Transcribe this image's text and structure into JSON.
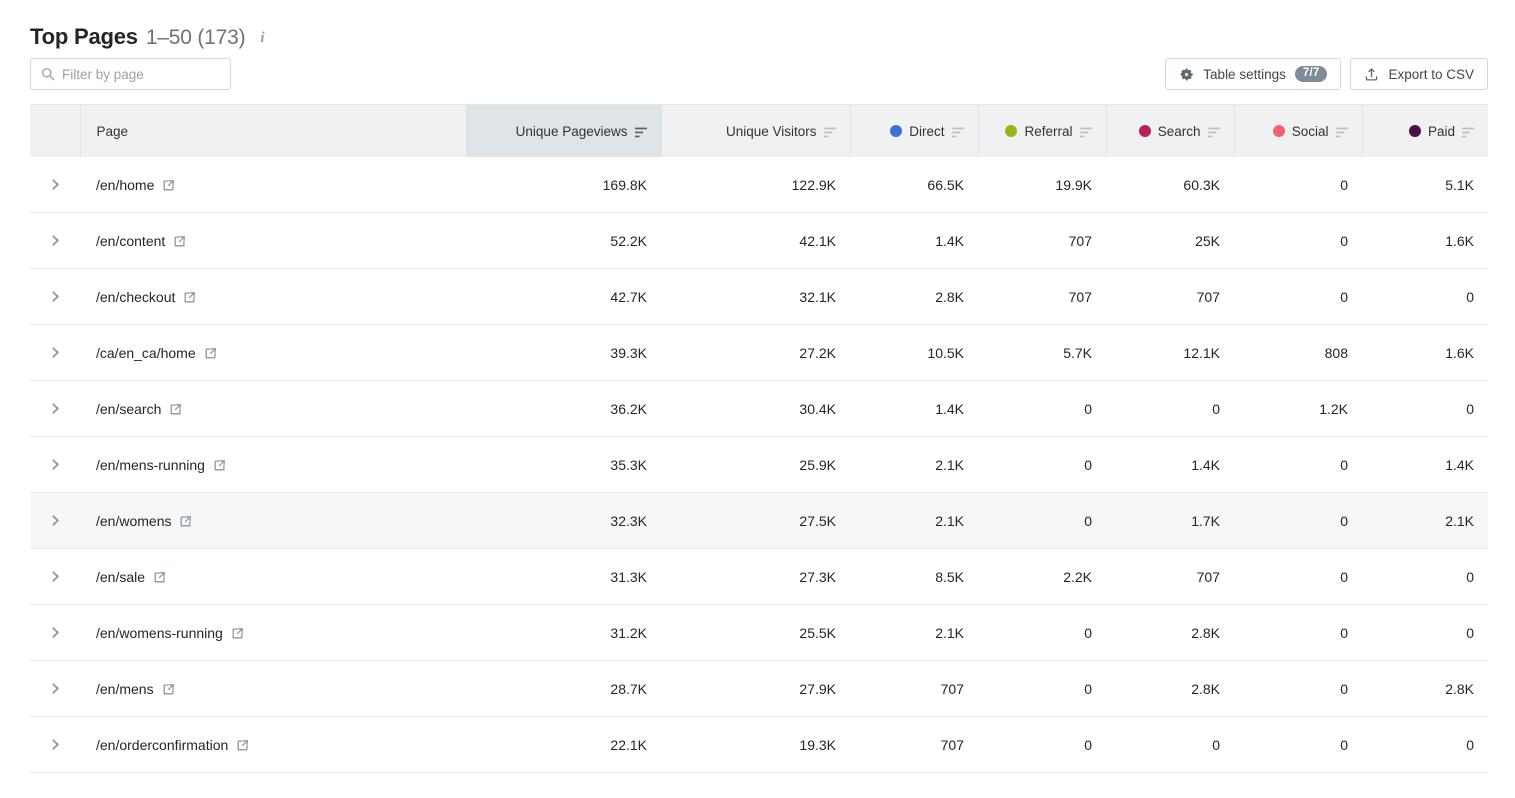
{
  "header": {
    "title": "Top Pages",
    "range": "1–50 (173)",
    "info_icon": "info-icon"
  },
  "toolbar": {
    "search_placeholder": "Filter by page",
    "search_value": "",
    "search_icon": "search-icon",
    "table_settings_label": "Table settings",
    "table_settings_badge": "7/7",
    "gear_icon": "gear-icon",
    "export_label": "Export to CSV",
    "export_icon": "export-icon"
  },
  "table": {
    "sorted_column": "Unique Pageviews",
    "columns": [
      {
        "label": "Page",
        "align": "left",
        "dot": null,
        "sorted": false
      },
      {
        "label": "Unique Pageviews",
        "align": "right",
        "dot": null,
        "sorted": true
      },
      {
        "label": "Unique Visitors",
        "align": "right",
        "dot": null,
        "sorted": false
      },
      {
        "label": "Direct",
        "align": "right",
        "dot": "#3c72d2",
        "sorted": false
      },
      {
        "label": "Referral",
        "align": "right",
        "dot": "#8fb814",
        "sorted": false
      },
      {
        "label": "Search",
        "align": "right",
        "dot": "#bc1f5f",
        "sorted": false
      },
      {
        "label": "Social",
        "align": "right",
        "dot": "#f4626b",
        "sorted": false
      },
      {
        "label": "Paid",
        "align": "right",
        "dot": "#4b0f4b",
        "sorted": false
      }
    ],
    "rows": [
      {
        "page": "/en/home",
        "unique_pageviews": "169.8K",
        "unique_visitors": "122.9K",
        "direct": "66.5K",
        "referral": "19.9K",
        "search": "60.3K",
        "social": "0",
        "paid": "5.1K",
        "hovered": false
      },
      {
        "page": "/en/content",
        "unique_pageviews": "52.2K",
        "unique_visitors": "42.1K",
        "direct": "1.4K",
        "referral": "707",
        "search": "25K",
        "social": "0",
        "paid": "1.6K",
        "hovered": false
      },
      {
        "page": "/en/checkout",
        "unique_pageviews": "42.7K",
        "unique_visitors": "32.1K",
        "direct": "2.8K",
        "referral": "707",
        "search": "707",
        "social": "0",
        "paid": "0",
        "hovered": false
      },
      {
        "page": "/ca/en_ca/home",
        "unique_pageviews": "39.3K",
        "unique_visitors": "27.2K",
        "direct": "10.5K",
        "referral": "5.7K",
        "search": "12.1K",
        "social": "808",
        "paid": "1.6K",
        "hovered": false
      },
      {
        "page": "/en/search",
        "unique_pageviews": "36.2K",
        "unique_visitors": "30.4K",
        "direct": "1.4K",
        "referral": "0",
        "search": "0",
        "social": "1.2K",
        "paid": "0",
        "hovered": false
      },
      {
        "page": "/en/mens-running",
        "unique_pageviews": "35.3K",
        "unique_visitors": "25.9K",
        "direct": "2.1K",
        "referral": "0",
        "search": "1.4K",
        "social": "0",
        "paid": "1.4K",
        "hovered": false
      },
      {
        "page": "/en/womens",
        "unique_pageviews": "32.3K",
        "unique_visitors": "27.5K",
        "direct": "2.1K",
        "referral": "0",
        "search": "1.7K",
        "social": "0",
        "paid": "2.1K",
        "hovered": true
      },
      {
        "page": "/en/sale",
        "unique_pageviews": "31.3K",
        "unique_visitors": "27.3K",
        "direct": "8.5K",
        "referral": "2.2K",
        "search": "707",
        "social": "0",
        "paid": "0",
        "hovered": false
      },
      {
        "page": "/en/womens-running",
        "unique_pageviews": "31.2K",
        "unique_visitors": "25.5K",
        "direct": "2.1K",
        "referral": "0",
        "search": "2.8K",
        "social": "0",
        "paid": "0",
        "hovered": false
      },
      {
        "page": "/en/mens",
        "unique_pageviews": "28.7K",
        "unique_visitors": "27.9K",
        "direct": "707",
        "referral": "0",
        "search": "2.8K",
        "social": "0",
        "paid": "2.8K",
        "hovered": false
      },
      {
        "page": "/en/orderconfirmation",
        "unique_pageviews": "22.1K",
        "unique_visitors": "19.3K",
        "direct": "707",
        "referral": "0",
        "search": "0",
        "social": "0",
        "paid": "0",
        "hovered": false
      }
    ]
  }
}
